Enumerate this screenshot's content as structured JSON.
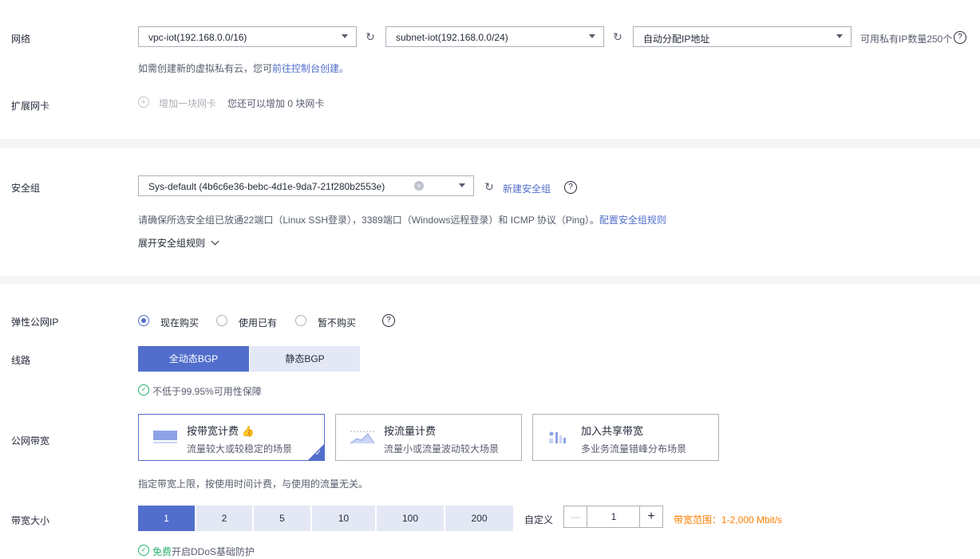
{
  "network": {
    "label": "网络",
    "vpc_value": "vpc-iot(192.168.0.0/16)",
    "subnet_value": "subnet-iot(192.168.0.0/24)",
    "ip_value": "自动分配IP地址",
    "ip_count": "可用私有IP数量250个",
    "hint_prefix": "如需创建新的虚拟私有云，您可",
    "hint_link": "前往控制台创建。"
  },
  "ext_nic": {
    "label": "扩展网卡",
    "add_label": "增加一块网卡",
    "hint": "您还可以增加 0 块网卡"
  },
  "security_group": {
    "label": "安全组",
    "value": "Sys-default (4b6c6e36-bebc-4d1e-9da7-21f280b2553e)",
    "new_link": "新建安全组",
    "hint": "请确保所选安全组已放通22端口（Linux SSH登录），3389端口（Windows远程登录）和 ICMP 协议（Ping）。",
    "hint_link": "配置安全组规则",
    "expand": "展开安全组规则"
  },
  "eip": {
    "label": "弹性公网IP",
    "options": [
      "现在购买",
      "使用已有",
      "暂不购买"
    ],
    "selected_index": 0
  },
  "line": {
    "label": "线路",
    "options": [
      "全动态BGP",
      "静态BGP"
    ],
    "selected_index": 0,
    "guarantee": "不低于99.95%可用性保障"
  },
  "bandwidth": {
    "label": "公网带宽",
    "cards": [
      {
        "title": "按带宽计费",
        "desc": "流量较大或较稳定的场景"
      },
      {
        "title": "按流量计费",
        "desc": "流量小或流量波动较大场景"
      },
      {
        "title": "加入共享带宽",
        "desc": "多业务流量错峰分布场景"
      }
    ],
    "selected_index": 0,
    "note": "指定带宽上限，按使用时间计费，与使用的流量无关。"
  },
  "bw_size": {
    "label": "带宽大小",
    "options": [
      "1",
      "2",
      "5",
      "10",
      "100",
      "200"
    ],
    "selected_index": 0,
    "custom_label": "自定义",
    "stepper_minus": "—",
    "stepper_value": "1",
    "stepper_plus": "+",
    "range": "带宽范围：1-2,000 Mbit/s",
    "ddos_free": "免费",
    "ddos_text": "开启DDoS基础防护"
  },
  "colors": {
    "accent": "#526ecc",
    "success": "#26b26b",
    "warning": "#ff7d00"
  }
}
